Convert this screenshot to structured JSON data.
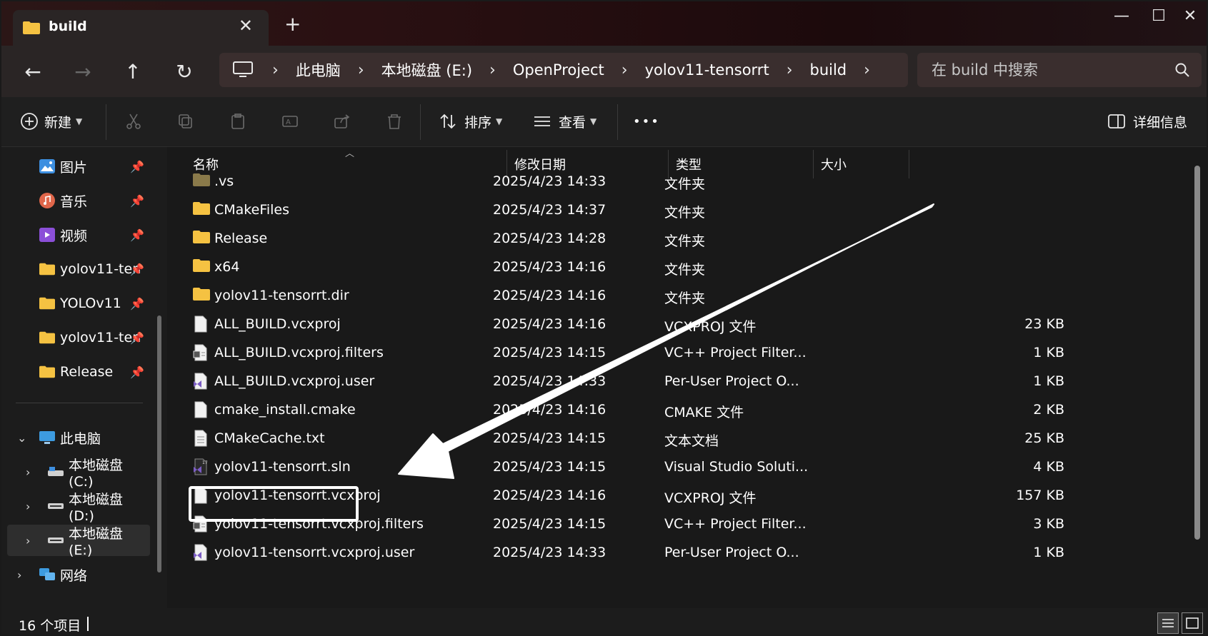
{
  "tab": {
    "title": "build",
    "close": "✕",
    "new_tab": "+"
  },
  "window_controls": {
    "minimize": "—",
    "maximize": "☐",
    "close": "✕"
  },
  "nav": {
    "back": "←",
    "forward": "→",
    "up": "↑",
    "refresh": "↻"
  },
  "breadcrumbs": [
    "此电脑",
    "本地磁盘 (E:)",
    "OpenProject",
    "yolov11-tensorrt",
    "build"
  ],
  "breadcrumb_sep": "›",
  "search": {
    "placeholder": "在 build 中搜索"
  },
  "commands": {
    "new": "新建",
    "sort": "排序",
    "view": "查看",
    "more": "•••",
    "details": "详细信息"
  },
  "sidebar": {
    "quick": [
      {
        "label": "图片",
        "icon": "pictures-icon"
      },
      {
        "label": "音乐",
        "icon": "music-icon"
      },
      {
        "label": "视频",
        "icon": "videos-icon"
      },
      {
        "label": "yolov11-ten",
        "icon": "folder-icon"
      },
      {
        "label": "YOLOv11",
        "icon": "folder-icon"
      },
      {
        "label": "yolov11-ten",
        "icon": "folder-icon"
      },
      {
        "label": "Release",
        "icon": "folder-icon"
      }
    ],
    "this_pc": "此电脑",
    "drives": [
      "本地磁盘 (C:)",
      "本地磁盘 (D:)",
      "本地磁盘 (E:)"
    ],
    "network": "网络"
  },
  "columns": {
    "name": "名称",
    "date": "修改日期",
    "type": "类型",
    "size": "大小"
  },
  "files": [
    {
      "name": ".vs",
      "date": "2025/4/23 14:33",
      "type": "文件夹",
      "size": "",
      "icon": "folder-dark"
    },
    {
      "name": "CMakeFiles",
      "date": "2025/4/23 14:37",
      "type": "文件夹",
      "size": "",
      "icon": "folder"
    },
    {
      "name": "Release",
      "date": "2025/4/23 14:28",
      "type": "文件夹",
      "size": "",
      "icon": "folder"
    },
    {
      "name": "x64",
      "date": "2025/4/23 14:16",
      "type": "文件夹",
      "size": "",
      "icon": "folder"
    },
    {
      "name": "yolov11-tensorrt.dir",
      "date": "2025/4/23 14:16",
      "type": "文件夹",
      "size": "",
      "icon": "folder"
    },
    {
      "name": "ALL_BUILD.vcxproj",
      "date": "2025/4/23 14:16",
      "type": "VCXPROJ 文件",
      "size": "23 KB",
      "icon": "file"
    },
    {
      "name": "ALL_BUILD.vcxproj.filters",
      "date": "2025/4/23 14:15",
      "type": "VC++ Project Filter...",
      "size": "1 KB",
      "icon": "filters"
    },
    {
      "name": "ALL_BUILD.vcxproj.user",
      "date": "2025/4/23 14:33",
      "type": "Per-User Project O...",
      "size": "1 KB",
      "icon": "vsuser"
    },
    {
      "name": "cmake_install.cmake",
      "date": "2025/4/23 14:16",
      "type": "CMAKE 文件",
      "size": "2 KB",
      "icon": "file"
    },
    {
      "name": "CMakeCache.txt",
      "date": "2025/4/23 14:15",
      "type": "文本文档",
      "size": "25 KB",
      "icon": "text"
    },
    {
      "name": "yolov11-tensorrt.sln",
      "date": "2025/4/23 14:15",
      "type": "Visual Studio Soluti...",
      "size": "4 KB",
      "icon": "sln"
    },
    {
      "name": "yolov11-tensorrt.vcxproj",
      "date": "2025/4/23 14:16",
      "type": "VCXPROJ 文件",
      "size": "157 KB",
      "icon": "file"
    },
    {
      "name": "yolov11-tensorrt.vcxproj.filters",
      "date": "2025/4/23 14:15",
      "type": "VC++ Project Filter...",
      "size": "3 KB",
      "icon": "filters"
    },
    {
      "name": "yolov11-tensorrt.vcxproj.user",
      "date": "2025/4/23 14:33",
      "type": "Per-User Project O...",
      "size": "1 KB",
      "icon": "vsuser"
    }
  ],
  "status": {
    "item_count": "16 个项目"
  },
  "colors": {
    "accent_folder": "#f5c242",
    "highlight": "#ffffff",
    "vs_purple": "#7b5cc4"
  }
}
